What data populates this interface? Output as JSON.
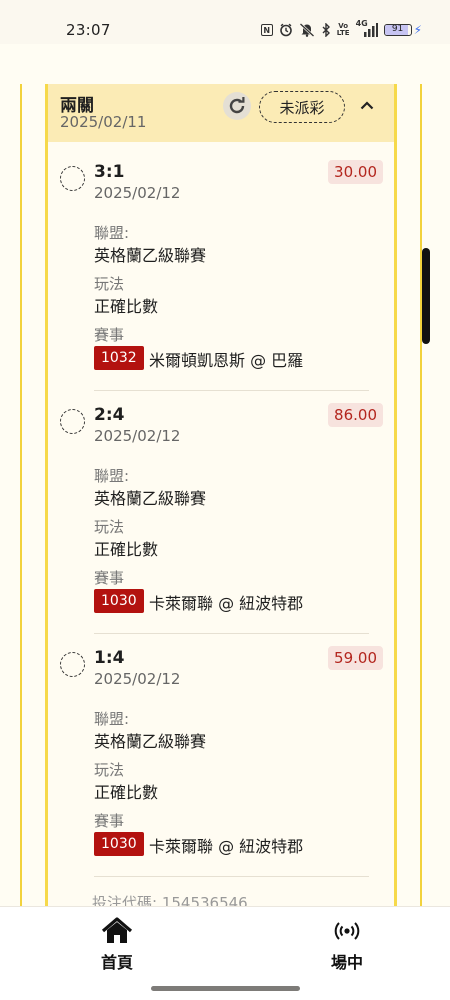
{
  "status_bar": {
    "time": "23:07",
    "icons": [
      "nfc-icon",
      "alarm-icon",
      "mute-icon",
      "bluetooth-icon",
      "volte-icon",
      "signal-4g-icon"
    ],
    "nfc_text": "N",
    "volte_text": "Vo\nLTE",
    "network_text": "4G",
    "battery_level": "91",
    "battery_fraction": 0.91
  },
  "bet": {
    "type": "兩關",
    "date": "2025/02/11",
    "status": "未派彩",
    "selections": [
      {
        "score": "3:1",
        "date": "2025/02/12",
        "odds": "30.00",
        "league_label": "聯盟:",
        "league": "英格蘭乙級聯賽",
        "play_label": "玩法",
        "play": "正確比數",
        "event_label": "賽事",
        "match_id": "1032",
        "match": "米爾頓凱恩斯 @ 巴羅"
      },
      {
        "score": "2:4",
        "date": "2025/02/12",
        "odds": "86.00",
        "league_label": "聯盟:",
        "league": "英格蘭乙級聯賽",
        "play_label": "玩法",
        "play": "正確比數",
        "event_label": "賽事",
        "match_id": "1030",
        "match": "卡萊爾聯 @ 紐波特郡"
      },
      {
        "score": "1:4",
        "date": "2025/02/12",
        "odds": "59.00",
        "league_label": "聯盟:",
        "league": "英格蘭乙級聯賽",
        "play_label": "玩法",
        "play": "正確比數",
        "event_label": "賽事",
        "match_id": "1030",
        "match": "卡萊爾聯 @ 紐波特郡"
      }
    ],
    "bet_code": "投注代碼: 154536546"
  },
  "nav": {
    "home_label": "首頁",
    "live_label": "場中"
  },
  "colors": {
    "header_bg": "#fbebb5",
    "frame": "#f6d94a",
    "odds_text": "#b3261e",
    "odds_bg": "#f7e3de",
    "match_id_bg": "#b3120f"
  }
}
